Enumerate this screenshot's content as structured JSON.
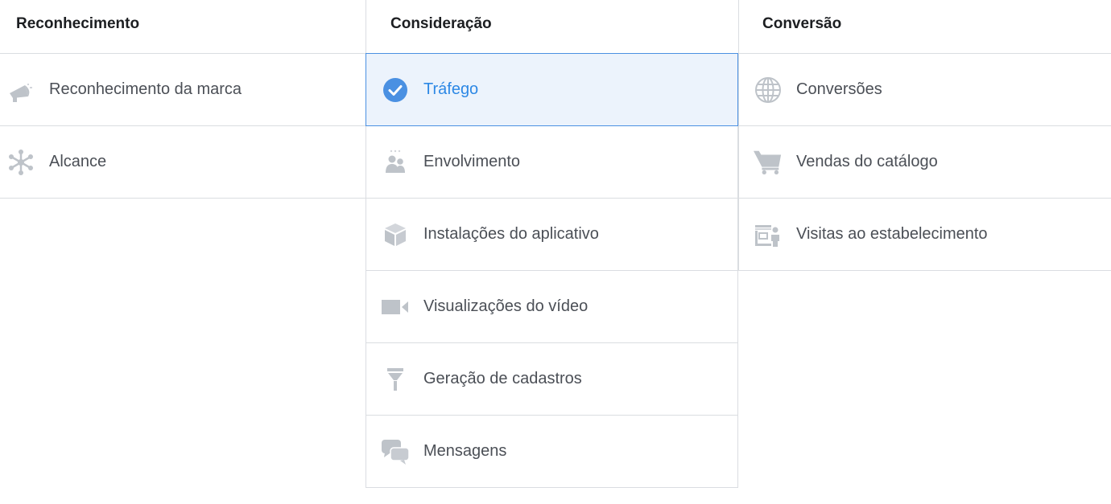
{
  "columns": [
    {
      "title": "Reconhecimento",
      "items": [
        {
          "label": "Reconhecimento da marca",
          "icon": "megaphone-icon"
        },
        {
          "label": "Alcance",
          "icon": "reach-network-icon"
        }
      ]
    },
    {
      "title": "Consideração",
      "items": [
        {
          "label": "Tráfego",
          "icon": "checkmark-circle-icon",
          "selected": true
        },
        {
          "label": "Envolvimento",
          "icon": "people-icon"
        },
        {
          "label": "Instalações do aplicativo",
          "icon": "cube-icon"
        },
        {
          "label": "Visualizações do vídeo",
          "icon": "video-camera-icon"
        },
        {
          "label": "Geração de cadastros",
          "icon": "funnel-icon"
        },
        {
          "label": "Mensagens",
          "icon": "chat-bubbles-icon"
        }
      ]
    },
    {
      "title": "Conversão",
      "items": [
        {
          "label": "Conversões",
          "icon": "globe-icon"
        },
        {
          "label": "Vendas do catálogo",
          "icon": "shopping-cart-icon"
        },
        {
          "label": "Visitas ao estabelecimento",
          "icon": "store-visit-icon"
        }
      ]
    }
  ],
  "colors": {
    "icon_gray": "#bec3c9",
    "selected_blue": "#4a90e2",
    "selected_bg": "#ecf3fc",
    "selected_text": "#2d88e5",
    "border": "#dadde1"
  }
}
